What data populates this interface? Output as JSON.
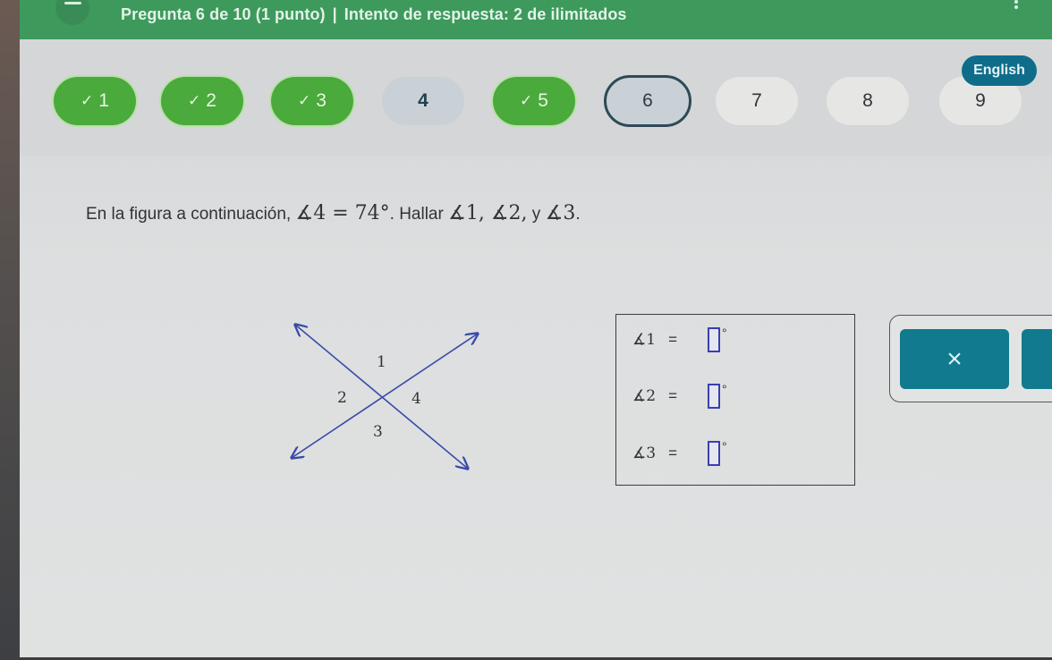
{
  "header": {
    "question_info": "Pregunta 6 de 10 (1 punto)",
    "separator": "|",
    "attempt_info": "Intento de respuesta: 2 de ilimitados"
  },
  "navigation": {
    "language_label": "English",
    "questions": [
      {
        "number": "1",
        "state": "answered",
        "check": "✓"
      },
      {
        "number": "2",
        "state": "answered",
        "check": "✓"
      },
      {
        "number": "3",
        "state": "answered",
        "check": "✓"
      },
      {
        "number": "4",
        "state": "unanswered",
        "check": ""
      },
      {
        "number": "5",
        "state": "answered",
        "check": "✓"
      },
      {
        "number": "6",
        "state": "current",
        "check": ""
      },
      {
        "number": "7",
        "state": "not-visited",
        "check": ""
      },
      {
        "number": "8",
        "state": "not-visited",
        "check": ""
      },
      {
        "number": "9",
        "state": "not-visited",
        "check": ""
      }
    ]
  },
  "question": {
    "intro": "En la figura a continuación, ",
    "given": "∡4 = 74°",
    "middle": ". Hallar ",
    "targets": "∡1, ∡2,",
    "conj": " y ",
    "last": "∡3",
    "end": "."
  },
  "figure": {
    "labels": [
      "1",
      "2",
      "3",
      "4"
    ]
  },
  "answers": {
    "rows": [
      {
        "label": "∡1",
        "eq": "=",
        "value": "",
        "unit": "°"
      },
      {
        "label": "∡2",
        "eq": "=",
        "value": "",
        "unit": "°"
      },
      {
        "label": "∡3",
        "eq": "=",
        "value": "",
        "unit": "°"
      }
    ]
  },
  "actions": {
    "clear_symbol": "×"
  },
  "colors": {
    "header_green": "#3d9a5c",
    "answered_green": "#4aaa3c",
    "accent_teal": "#117a8f",
    "language_blue": "#0f6d8a",
    "line_blue": "#3a4aa8"
  }
}
